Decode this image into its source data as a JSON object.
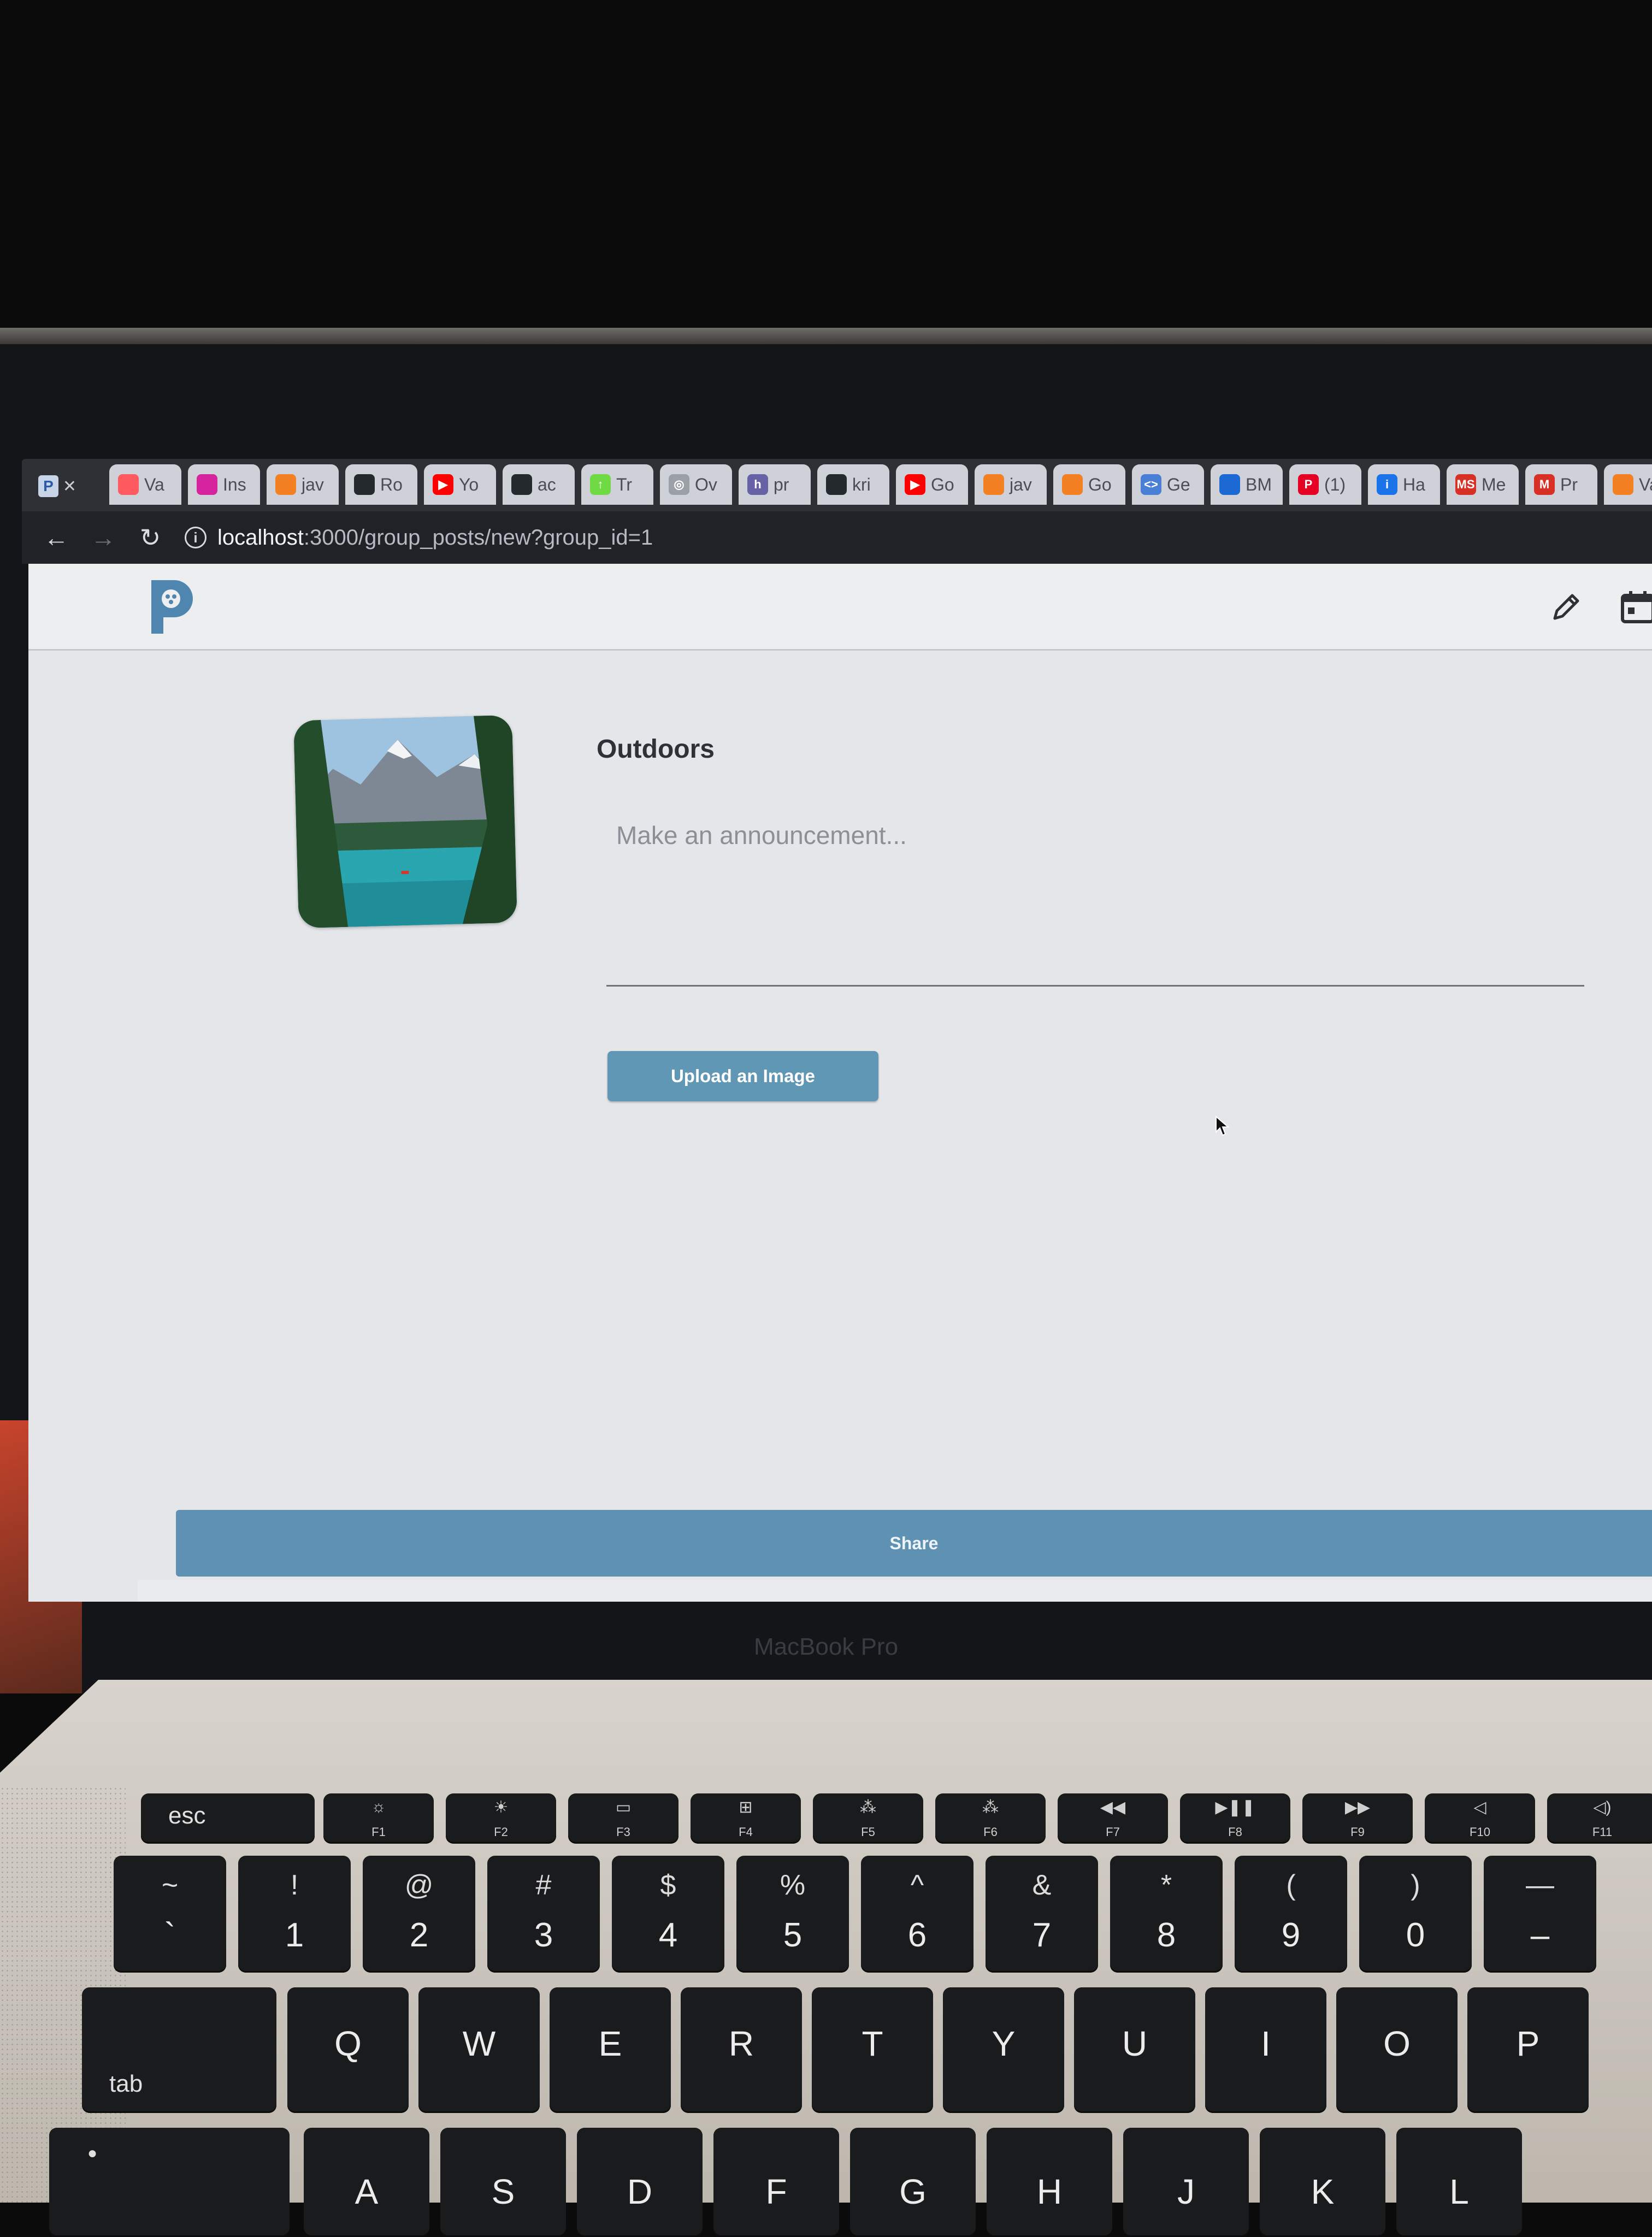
{
  "browser": {
    "tabs": [
      {
        "title": "Va",
        "icon": "airbnb-icon",
        "color": "#ff5a5f"
      },
      {
        "title": "Ins",
        "icon": "instagram-icon",
        "color": "#d6249f"
      },
      {
        "title": "jav",
        "icon": "stackoverflow-icon",
        "color": "#f48024"
      },
      {
        "title": "Ro",
        "icon": "github-icon",
        "color": "#24292e"
      },
      {
        "title": "Yo",
        "icon": "youtube-icon",
        "color": "#ff0000"
      },
      {
        "title": "ac",
        "icon": "github-icon",
        "color": "#24292e"
      },
      {
        "title": "Tr",
        "icon": "upwork-icon",
        "color": "#6fda44"
      },
      {
        "title": "Ov",
        "icon": "chrome-icon",
        "color": "#9aa0a6"
      },
      {
        "title": "pr",
        "icon": "heroku-icon",
        "color": "#6762a6"
      },
      {
        "title": "kri",
        "icon": "github-icon",
        "color": "#24292e"
      },
      {
        "title": "Go",
        "icon": "youtube-icon",
        "color": "#ff0000"
      },
      {
        "title": "jav",
        "icon": "stackoverflow-icon",
        "color": "#f48024"
      },
      {
        "title": "Go",
        "icon": "stackoverflow-icon",
        "color": "#f48024"
      },
      {
        "title": "Ge",
        "icon": "code-icon",
        "color": "#4a7fd6"
      },
      {
        "title": "BM",
        "icon": "bmw-icon",
        "color": "#1c69d4"
      },
      {
        "title": "(1)",
        "icon": "pinterest-icon",
        "color": "#e60023"
      },
      {
        "title": "Ha",
        "icon": "info-icon",
        "color": "#1a73e8"
      },
      {
        "title": "Me",
        "icon": "ms-icon",
        "color": "#d93025"
      },
      {
        "title": "Pr",
        "icon": "gmail-icon",
        "color": "#d93025"
      },
      {
        "title": "Va",
        "icon": "stackoverflow-icon",
        "color": "#f48024"
      }
    ],
    "tab_favicon_letters": [
      "",
      "",
      "",
      "",
      "▶",
      "",
      "↑",
      "◎",
      "h",
      "",
      "▶",
      "",
      "",
      "<>",
      "",
      "P",
      "i",
      "MS",
      "M",
      ""
    ],
    "url_host": "localhost",
    "url_path": ":3000/group_posts/new?group_id=1"
  },
  "site": {
    "group_name": "Outdoors",
    "announcement_placeholder": "Make an announcement...",
    "upload_label": "Upload an Image",
    "share_label": "Share",
    "accent_color": "#5f97b4"
  },
  "laptop": {
    "bezel_label": "MacBook Pro"
  },
  "keyboard": {
    "esc": "esc",
    "tab": "tab",
    "fkeys": [
      "F1",
      "F2",
      "F3",
      "F4",
      "F5",
      "F6",
      "F7",
      "F8",
      "F9",
      "F10",
      "F11"
    ],
    "number_row": [
      {
        "top": "~",
        "bot": "`"
      },
      {
        "top": "!",
        "bot": "1"
      },
      {
        "top": "@",
        "bot": "2"
      },
      {
        "top": "#",
        "bot": "3"
      },
      {
        "top": "$",
        "bot": "4"
      },
      {
        "top": "%",
        "bot": "5"
      },
      {
        "top": "^",
        "bot": "6"
      },
      {
        "top": "&",
        "bot": "7"
      },
      {
        "top": "*",
        "bot": "8"
      },
      {
        "top": "(",
        "bot": "9"
      },
      {
        "top": ")",
        "bot": "0"
      },
      {
        "top": "—",
        "bot": "–"
      }
    ],
    "qwerty_row": [
      "Q",
      "W",
      "E",
      "R",
      "T",
      "Y",
      "U",
      "I",
      "O",
      "P"
    ],
    "home_row": [
      "A",
      "S",
      "D",
      "F",
      "G",
      "H",
      "J",
      "K",
      "L"
    ]
  }
}
